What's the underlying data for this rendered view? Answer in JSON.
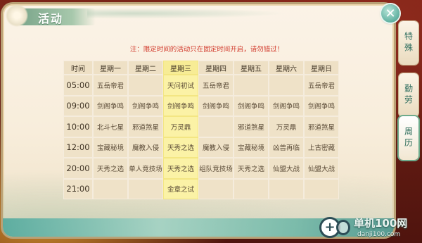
{
  "title": "活动",
  "notice": "注：限定时间的活动只在固定时间开启，请勿错过！",
  "close_icon": "close-icon",
  "table": {
    "header": [
      "时间",
      "星期一",
      "星期二",
      "星期三",
      "星期四",
      "星期五",
      "星期六",
      "星期日"
    ],
    "highlight_column": 3,
    "rows": [
      {
        "time": "05:00",
        "cells": [
          "五岳帝君",
          "",
          "天问初试",
          "五岳帝君",
          "",
          "",
          "五岳帝君"
        ]
      },
      {
        "time": "09:00",
        "cells": [
          "剑阁争鸣",
          "剑阁争鸣",
          "剑阁争鸣",
          "剑阁争鸣",
          "剑阁争鸣",
          "剑阁争鸣",
          "剑阁争鸣"
        ]
      },
      {
        "time": "10:00",
        "cells": [
          "北斗七星",
          "邪道煞星",
          "万灵鼎",
          "",
          "邪道煞星",
          "万灵鼎",
          "邪道煞星"
        ]
      },
      {
        "time": "12:00",
        "cells": [
          "宝藏秘境",
          "魔教入侵",
          "天秀之选",
          "魔教入侵",
          "宝藏秘境",
          "凶兽再临",
          "上古密藏"
        ]
      },
      {
        "time": "20:00",
        "cells": [
          "天秀之选",
          "单人竞技场",
          "天秀之选",
          "组队竞技场",
          "天秀之选",
          "仙盟大战",
          "仙盟大战"
        ]
      },
      {
        "time": "21:00",
        "cells": [
          "",
          "",
          "金章之试",
          "",
          "",
          "",
          ""
        ]
      }
    ]
  },
  "side_tabs": [
    {
      "label": "特殊",
      "active": false
    },
    {
      "label": "勤劳",
      "active": false
    },
    {
      "label": "周历",
      "active": true
    }
  ],
  "watermark": {
    "title": "单机100网",
    "url": "danji100.com"
  }
}
